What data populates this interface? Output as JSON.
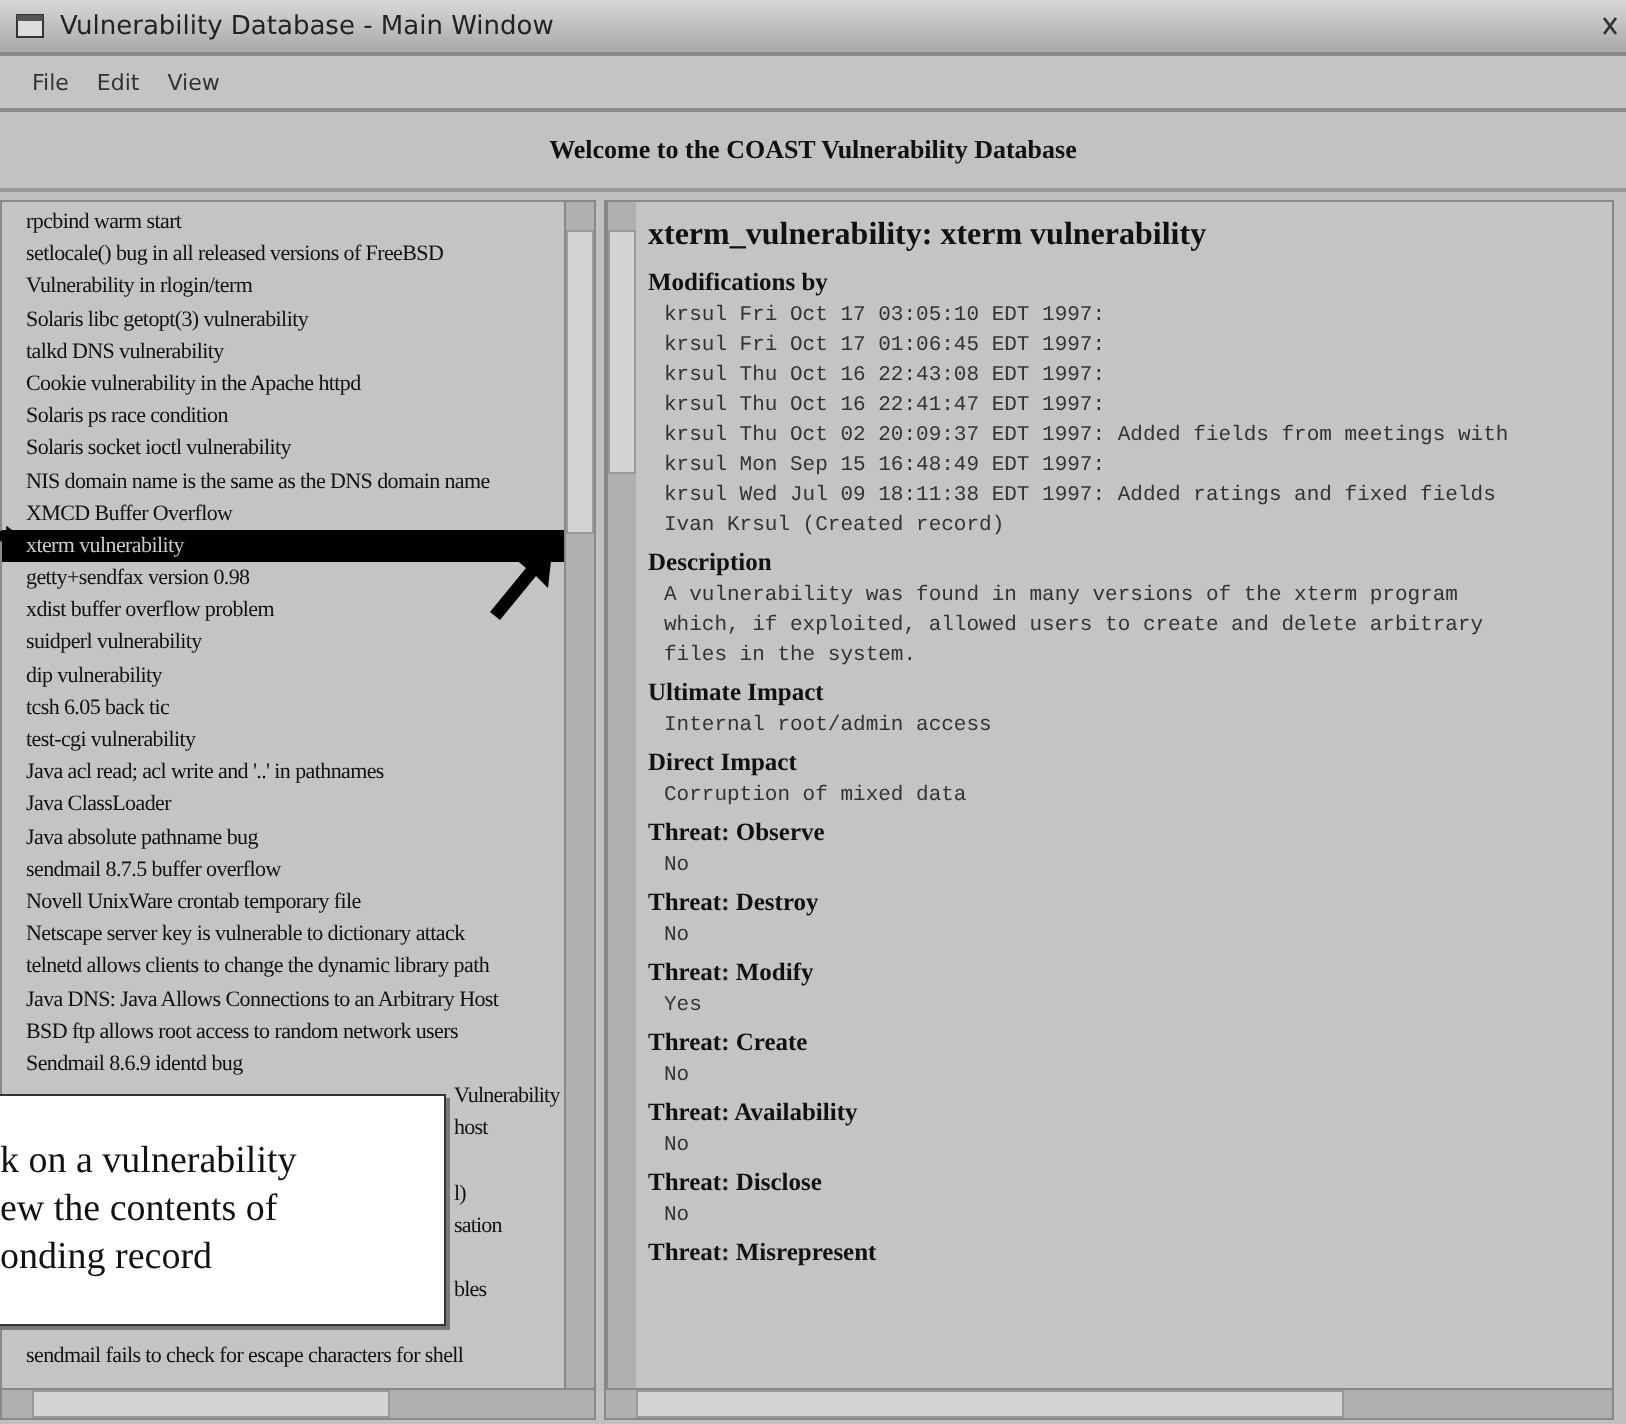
{
  "window": {
    "title": "Vulnerability Database - Main Window"
  },
  "menu": [
    "File",
    "Edit",
    "View"
  ],
  "banner": "Welcome to the COAST Vulnerability Database",
  "list": [
    {
      "kind": "item",
      "text": "rpcbind warm start",
      "selected": false
    },
    {
      "kind": "item",
      "text": "setlocale() bug in all released versions of FreeBSD",
      "selected": false
    },
    {
      "kind": "item",
      "text": "Vulnerability in rlogin/term",
      "selected": false
    },
    {
      "kind": "item",
      "text": "Solaris libc getopt(3) vulnerability",
      "selected": false
    },
    {
      "kind": "item",
      "text": "talkd DNS vulnerability",
      "selected": false
    },
    {
      "kind": "item",
      "text": "Cookie vulnerability in the Apache httpd",
      "selected": false
    },
    {
      "kind": "item",
      "text": "Solaris ps race condition",
      "selected": false
    },
    {
      "kind": "item",
      "text": "Solaris socket ioctl vulnerability",
      "selected": false
    },
    {
      "kind": "item",
      "text": "NIS domain name is the same as the DNS domain name",
      "selected": false
    },
    {
      "kind": "item",
      "text": "XMCD Buffer Overflow",
      "selected": false
    },
    {
      "kind": "item",
      "text": "xterm vulnerability",
      "selected": true
    },
    {
      "kind": "item",
      "text": "getty+sendfax version 0.98",
      "selected": false
    },
    {
      "kind": "item",
      "text": "xdist buffer overflow problem",
      "selected": false
    },
    {
      "kind": "item",
      "text": "suidperl vulnerability",
      "selected": false
    },
    {
      "kind": "item",
      "text": "dip vulnerability",
      "selected": false
    },
    {
      "kind": "item",
      "text": "tcsh 6.05 back tic",
      "selected": false
    },
    {
      "kind": "item",
      "text": "test-cgi vulnerability",
      "selected": false
    },
    {
      "kind": "item",
      "text": "Java acl read; acl write and '..' in pathnames",
      "selected": false
    },
    {
      "kind": "item",
      "text": "Java ClassLoader",
      "selected": false
    },
    {
      "kind": "item",
      "text": "Java absolute pathname bug",
      "selected": false
    },
    {
      "kind": "item",
      "text": "sendmail 8.7.5 buffer overflow",
      "selected": false
    },
    {
      "kind": "item",
      "text": "Novell UnixWare crontab temporary file",
      "selected": false
    },
    {
      "kind": "item",
      "text": "Netscape server key is vulnerable to dictionary attack",
      "selected": false
    },
    {
      "kind": "item",
      "text": "telnetd allows clients to change the dynamic library path",
      "selected": false
    },
    {
      "kind": "item",
      "text": "Java DNS: Java Allows Connections to an Arbitrary Host",
      "selected": false
    },
    {
      "kind": "item",
      "text": "BSD ftp allows root access to random network users",
      "selected": false
    },
    {
      "kind": "item",
      "text": "Sendmail 8.6.9 identd bug",
      "selected": false
    },
    {
      "kind": "partial",
      "text": "Vulnerability",
      "selected": false
    },
    {
      "kind": "partial",
      "text": "host",
      "selected": false
    },
    {
      "kind": "covered"
    },
    {
      "kind": "partial",
      "text": "l)",
      "selected": false
    },
    {
      "kind": "partial",
      "text": "sation",
      "selected": false
    },
    {
      "kind": "covered"
    },
    {
      "kind": "partial",
      "text": "bles",
      "selected": false
    },
    {
      "kind": "covered"
    },
    {
      "kind": "item",
      "text": "sendmail fails to check for escape characters for shell",
      "selected": false
    }
  ],
  "record": {
    "title": "xterm_vulnerability: xterm vulnerability",
    "sections": [
      {
        "label": "Modifications by",
        "lines": [
          "krsul Fri Oct 17 03:05:10 EDT 1997:",
          "krsul Fri Oct 17 01:06:45 EDT 1997:",
          "krsul Thu Oct 16 22:43:08 EDT 1997:",
          "krsul Thu Oct 16 22:41:47 EDT 1997:",
          "krsul Thu Oct 02 20:09:37 EDT 1997: Added fields from meetings with",
          "krsul Mon Sep 15 16:48:49 EDT 1997:",
          "krsul Wed Jul 09 18:11:38 EDT 1997: Added ratings and fixed fields",
          "Ivan Krsul (Created record)"
        ]
      },
      {
        "label": "Description",
        "lines": [
          "A vulnerability was found in many versions of the xterm program",
          "which, if exploited, allowed users to create and delete arbitrary",
          "files in the system."
        ]
      },
      {
        "label": "Ultimate Impact",
        "lines": [
          "Internal root/admin access"
        ]
      },
      {
        "label": "Direct Impact",
        "lines": [
          "Corruption of mixed data"
        ]
      },
      {
        "label": "Threat: Observe",
        "lines": [
          "No"
        ]
      },
      {
        "label": "Threat: Destroy",
        "lines": [
          "No"
        ]
      },
      {
        "label": "Threat: Modify",
        "lines": [
          "Yes"
        ]
      },
      {
        "label": "Threat: Create",
        "lines": [
          "No"
        ]
      },
      {
        "label": "Threat: Availability",
        "lines": [
          "No"
        ]
      },
      {
        "label": "Threat: Disclose",
        "lines": [
          "No"
        ]
      },
      {
        "label": "Threat: Misrepresent"
      }
    ]
  },
  "callout": {
    "lines": [
      "k on a vulnerability",
      "ew the contents of",
      "onding record"
    ]
  }
}
